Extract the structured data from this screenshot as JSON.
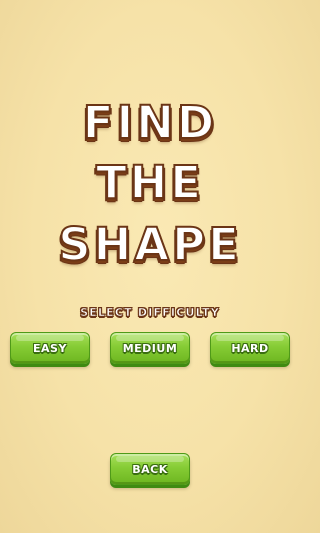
{
  "title": {
    "line1": "FIND",
    "line2": "THE",
    "line3": "SHAPE"
  },
  "subtitle": "SELECT DIFFICULTY",
  "difficulty_buttons": [
    {
      "label": "EASY"
    },
    {
      "label": "MEDIUM"
    },
    {
      "label": "HARD"
    }
  ],
  "back_button": {
    "label": "BACK"
  },
  "colors": {
    "background": "#f7e4ab",
    "title_fill": "#ffffff",
    "title_outline": "#6b3516",
    "button_green": "#86cc35",
    "button_dark_green": "#3f8a12"
  }
}
